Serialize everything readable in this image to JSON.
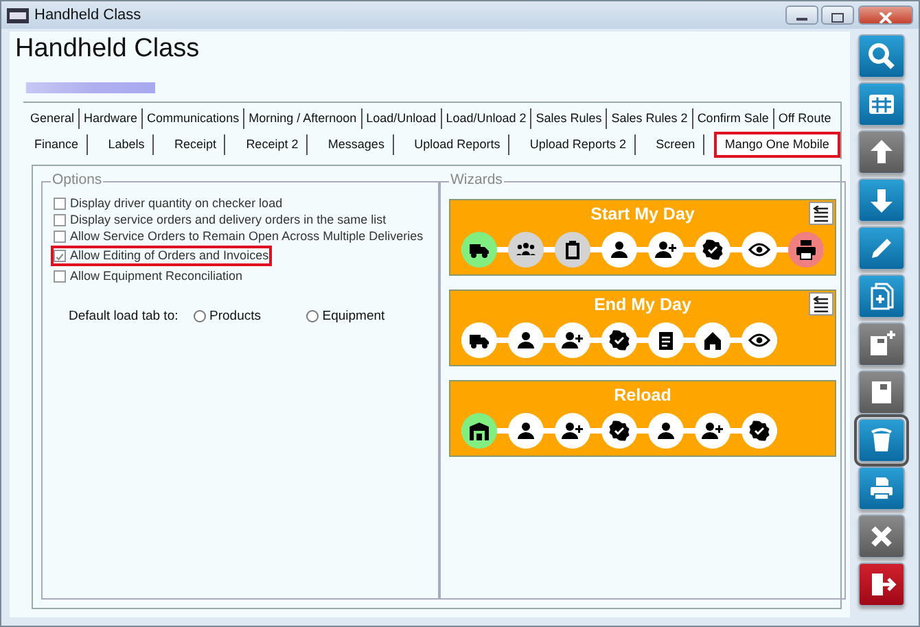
{
  "window": {
    "title": "Handheld Class"
  },
  "heading": "Handheld Class",
  "tab_rows": [
    [
      {
        "label": "General",
        "selected": false
      },
      {
        "label": "Hardware",
        "selected": false
      },
      {
        "label": "Communications",
        "selected": false
      },
      {
        "label": "Morning / Afternoon",
        "selected": false
      },
      {
        "label": "Load/Unload",
        "selected": false
      },
      {
        "label": "Load/Unload 2",
        "selected": false
      },
      {
        "label": "Sales Rules",
        "selected": false
      },
      {
        "label": "Sales Rules 2",
        "selected": false
      },
      {
        "label": "Confirm Sale",
        "selected": false
      },
      {
        "label": "Off Route",
        "selected": false
      }
    ],
    [
      {
        "label": "Finance",
        "selected": false
      },
      {
        "label": "Labels",
        "selected": false
      },
      {
        "label": "Receipt",
        "selected": false
      },
      {
        "label": "Receipt 2",
        "selected": false
      },
      {
        "label": "Messages",
        "selected": false
      },
      {
        "label": "Upload Reports",
        "selected": false
      },
      {
        "label": "Upload Reports 2",
        "selected": false
      },
      {
        "label": "Screen",
        "selected": false
      },
      {
        "label": "Mango One Mobile",
        "selected": true
      }
    ]
  ],
  "options": {
    "title": "Options",
    "items": [
      {
        "label": "Display driver quantity on checker load",
        "checked": false,
        "disabled": true,
        "highlighted": false
      },
      {
        "label": "Display service orders and delivery orders in the same list",
        "checked": false,
        "disabled": true,
        "highlighted": false
      },
      {
        "label": "Allow Service Orders to Remain Open Across Multiple Deliveries",
        "checked": false,
        "disabled": true,
        "highlighted": false
      },
      {
        "label": "Allow Editing of Orders and Invoices",
        "checked": true,
        "disabled": true,
        "highlighted": true
      },
      {
        "label": "Allow Equipment Reconciliation",
        "checked": false,
        "disabled": true,
        "highlighted": false
      }
    ],
    "default_load_tab": {
      "label": "Default load tab to:",
      "choices": [
        {
          "label": "Products",
          "selected": false
        },
        {
          "label": "Equipment",
          "selected": false
        }
      ]
    }
  },
  "wizards": {
    "title": "Wizards",
    "items": [
      {
        "title": "Start My Day",
        "reorder_button": true,
        "steps": [
          {
            "kind": "truck",
            "color": "#80ee80"
          },
          {
            "kind": "people",
            "color": "#d3d3d3"
          },
          {
            "kind": "clipboard",
            "color": "#d3d3d3"
          },
          {
            "kind": "person",
            "color": "#ffffff"
          },
          {
            "kind": "person-add",
            "color": "#ffffff"
          },
          {
            "kind": "badge",
            "color": "#ffffff"
          },
          {
            "kind": "eye",
            "color": "#ffffff"
          },
          {
            "kind": "printer",
            "color": "#f08080"
          }
        ]
      },
      {
        "title": "End My Day",
        "reorder_button": true,
        "steps": [
          {
            "kind": "truck",
            "color": "#ffffff"
          },
          {
            "kind": "person",
            "color": "#ffffff"
          },
          {
            "kind": "person-add",
            "color": "#ffffff"
          },
          {
            "kind": "badge",
            "color": "#ffffff"
          },
          {
            "kind": "document",
            "color": "#ffffff"
          },
          {
            "kind": "home",
            "color": "#ffffff"
          },
          {
            "kind": "eye",
            "color": "#ffffff"
          }
        ]
      },
      {
        "title": "Reload",
        "reorder_button": false,
        "steps": [
          {
            "kind": "warehouse",
            "color": "#80ee80"
          },
          {
            "kind": "person",
            "color": "#ffffff"
          },
          {
            "kind": "person-add",
            "color": "#ffffff"
          },
          {
            "kind": "badge",
            "color": "#ffffff"
          },
          {
            "kind": "person",
            "color": "#ffffff"
          },
          {
            "kind": "person-add",
            "color": "#ffffff"
          },
          {
            "kind": "badge",
            "color": "#ffffff"
          }
        ]
      }
    ]
  },
  "toolbar": [
    {
      "kind": "search",
      "disabled": false,
      "selected": false
    },
    {
      "kind": "grid",
      "disabled": false,
      "selected": false
    },
    {
      "kind": "up",
      "disabled": true,
      "selected": false
    },
    {
      "kind": "down",
      "disabled": false,
      "selected": false
    },
    {
      "kind": "edit",
      "disabled": false,
      "selected": false
    },
    {
      "kind": "new",
      "disabled": false,
      "selected": false
    },
    {
      "kind": "save-new",
      "disabled": true,
      "selected": false
    },
    {
      "kind": "save",
      "disabled": true,
      "selected": false
    },
    {
      "kind": "delete",
      "disabled": false,
      "selected": true
    },
    {
      "kind": "print",
      "disabled": false,
      "selected": false
    },
    {
      "kind": "cancel",
      "disabled": true,
      "selected": false
    },
    {
      "kind": "exit",
      "disabled": false,
      "selected": false
    }
  ]
}
